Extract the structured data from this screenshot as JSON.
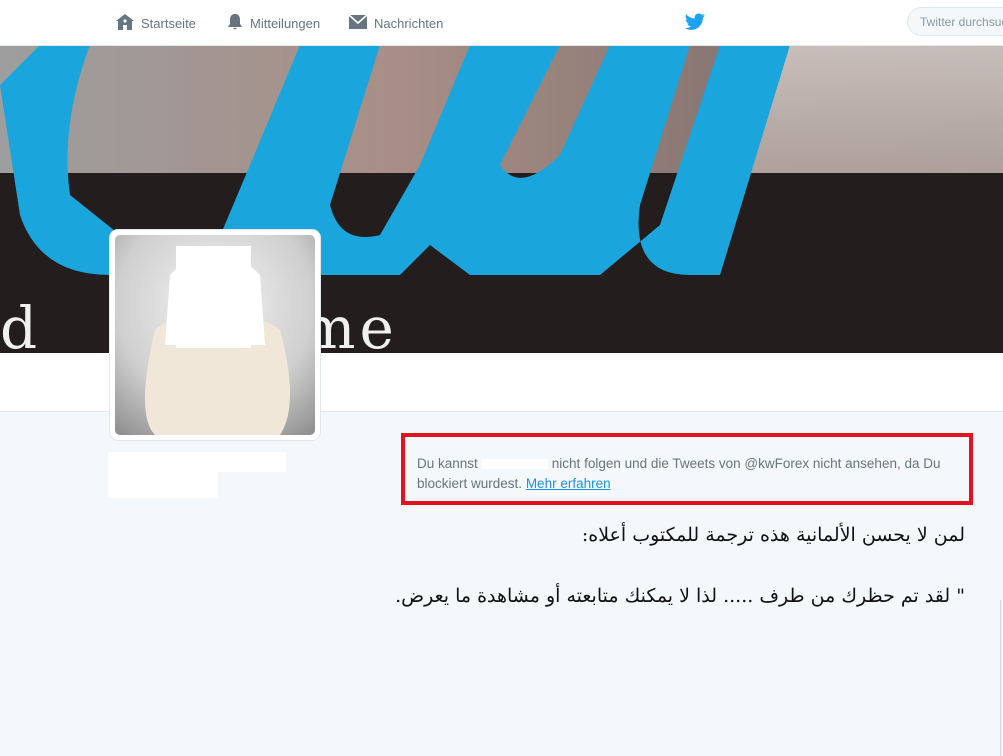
{
  "nav": {
    "home_label": "Startseite",
    "notifications_label": "Mitteilungen",
    "messages_label": "Nachrichten",
    "search_placeholder": "Twitter durchsuchen"
  },
  "icons": {
    "home": "home-icon",
    "notifications": "bell-icon",
    "messages": "envelope-icon",
    "brand": "twitter-bird-icon"
  },
  "colors": {
    "brand_blue": "#1da1f2",
    "highlight_red": "#e0141e",
    "link": "#1b95e0"
  },
  "banner": {
    "partial_text": "d        name"
  },
  "notice": {
    "text_before": "Du kannst",
    "text_after": "nicht folgen und die Tweets von @kwForex nicht ansehen, da Du blockiert wurdest.",
    "link_label": "Mehr erfahren"
  },
  "annotation": {
    "line1": "لمن لا يحسن الألمانية هذه ترجمة للمكتوب أعلاه:",
    "line2": "\" لقد تم حظرك من طرف ..... لذا لا يمكنك متابعته أو مشاهدة ما يعرض."
  }
}
